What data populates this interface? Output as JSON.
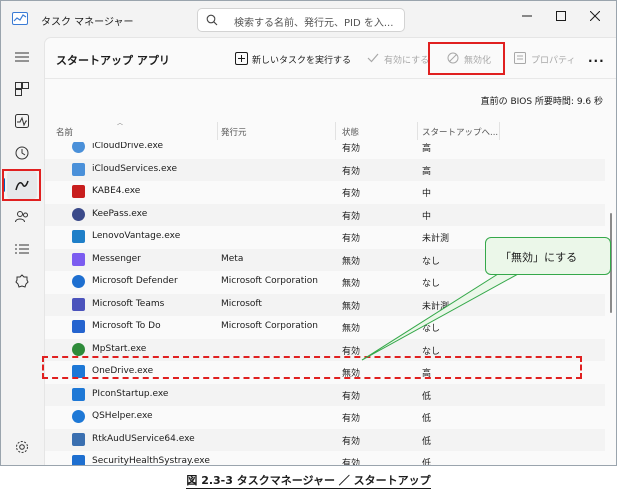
{
  "app": {
    "title": "タスク マネージャー"
  },
  "search": {
    "placeholder": "検索する名前、発行元、PID を入..."
  },
  "page": {
    "title": "スタートアップ アプリ"
  },
  "toolbar": {
    "new_task": "新しいタスクを実行する",
    "enable": "有効にする",
    "disable": "無効化",
    "properties": "プロパティ",
    "more": "..."
  },
  "bios": "直前の BIOS 所要時間:  9.6 秒",
  "columns": {
    "name": "名前",
    "publisher": "発行元",
    "status": "状態",
    "impact": "スタートアップへ..."
  },
  "rows": [
    {
      "icon": "icloud-icon",
      "name": "iCloudDrive.exe",
      "publisher": "",
      "status": "有効",
      "impact": "高",
      "color": "#4a90d9"
    },
    {
      "icon": "icloud-icon",
      "name": "iCloudServices.exe",
      "publisher": "",
      "status": "有効",
      "impact": "高",
      "color": "#4a90d9"
    },
    {
      "icon": "kabe4-icon",
      "name": "KABE4.exe",
      "publisher": "",
      "status": "有効",
      "impact": "中",
      "color": "#c81e1e"
    },
    {
      "icon": "keepass-icon",
      "name": "KeePass.exe",
      "publisher": "",
      "status": "有効",
      "impact": "中",
      "color": "#3b4a8a"
    },
    {
      "icon": "lenovo-icon",
      "name": "LenovoVantage.exe",
      "publisher": "",
      "status": "有効",
      "impact": "未計測",
      "color": "#1f7fc8"
    },
    {
      "icon": "messenger-icon",
      "name": "Messenger",
      "publisher": "Meta",
      "status": "無効",
      "impact": "なし",
      "color": "#7b5cf0"
    },
    {
      "icon": "defender-icon",
      "name": "Microsoft Defender",
      "publisher": "Microsoft Corporation",
      "status": "無効",
      "impact": "なし",
      "color": "#1e6fd0"
    },
    {
      "icon": "teams-icon",
      "name": "Microsoft Teams",
      "publisher": "Microsoft",
      "status": "無効",
      "impact": "未計測",
      "color": "#4b53bc"
    },
    {
      "icon": "todo-icon",
      "name": "Microsoft To Do",
      "publisher": "Microsoft Corporation",
      "status": "無効",
      "impact": "なし",
      "color": "#2564cf"
    },
    {
      "icon": "mpstart-icon",
      "name": "MpStart.exe",
      "publisher": "",
      "status": "有効",
      "impact": "なし",
      "color": "#2e8b3a"
    },
    {
      "icon": "onedrive-icon",
      "name": "OneDrive.exe",
      "publisher": "",
      "status": "無効",
      "impact": "高",
      "color": "#1e78d6"
    },
    {
      "icon": "picon-icon",
      "name": "PIconStartup.exe",
      "publisher": "",
      "status": "有効",
      "impact": "低",
      "color": "#1e78d6"
    },
    {
      "icon": "qshelper-icon",
      "name": "QSHelper.exe",
      "publisher": "",
      "status": "有効",
      "impact": "低",
      "color": "#1e78d6"
    },
    {
      "icon": "rtkaud-icon",
      "name": "RtkAudUService64.exe",
      "publisher": "",
      "status": "有効",
      "impact": "低",
      "color": "#3a6fb0"
    },
    {
      "icon": "securityhealth-icon",
      "name": "SecurityHealthSystray.exe",
      "publisher": "",
      "status": "有効",
      "impact": "低",
      "color": "#1e6fd0"
    }
  ],
  "callout": "「無効」にする",
  "caption": "図 2.3-3  タスクマネージャー ／ スタートアップ",
  "colors": {
    "accent": "#005fb8",
    "highlight": "#e02020",
    "callout_border": "#35a84a",
    "callout_bg": "#ebf7e9"
  }
}
